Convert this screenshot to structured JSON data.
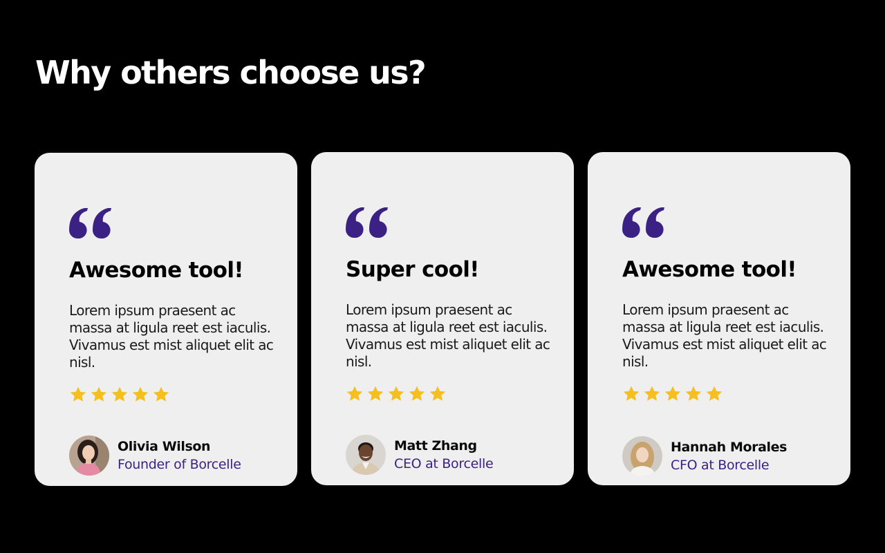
{
  "heading": "Why others choose us?",
  "colors": {
    "background": "#000000",
    "card": "#efefef",
    "accent": "#3b2184",
    "star": "#f5bf1f"
  },
  "testimonials": [
    {
      "title": "Awesome tool!",
      "body": "Lorem ipsum praesent ac massa at ligula reet est iaculis. Vivamus est mist aliquet elit ac nisl.",
      "rating": 5,
      "name": "Olivia Wilson",
      "role": "Founder of Borcelle",
      "avatar": "woman-dark-hair-avatar"
    },
    {
      "title": "Super cool!",
      "body": "Lorem ipsum praesent ac massa at ligula reet est iaculis. Vivamus est mist aliquet elit ac nisl.",
      "rating": 5,
      "name": "Matt Zhang",
      "role": "CEO at Borcelle",
      "avatar": "man-smiling-avatar"
    },
    {
      "title": "Awesome tool!",
      "body": "Lorem ipsum praesent ac massa at ligula reet est iaculis. Vivamus est mist aliquet elit ac nisl.",
      "rating": 5,
      "name": "Hannah Morales",
      "role": "CFO at Borcelle",
      "avatar": "woman-blonde-hair-avatar"
    }
  ]
}
